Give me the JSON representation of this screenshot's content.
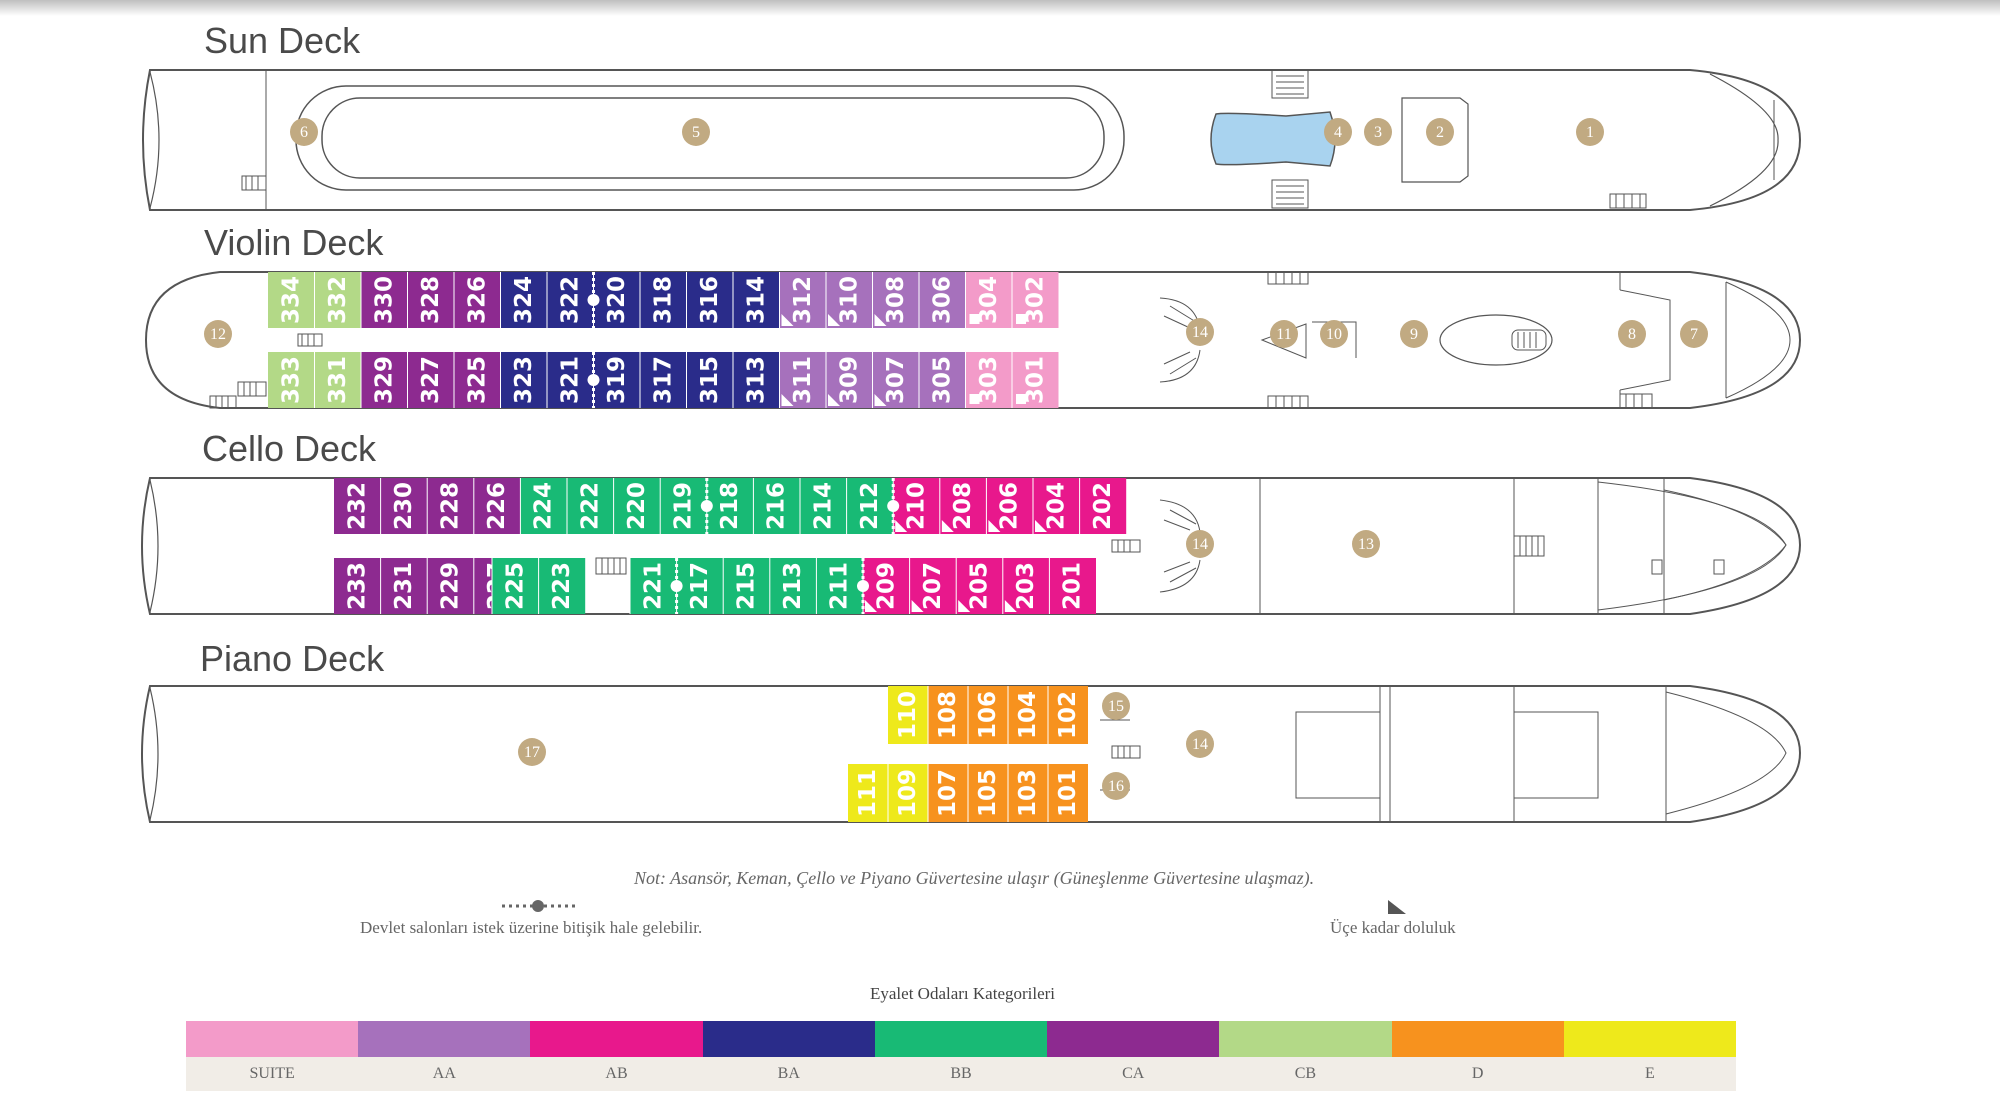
{
  "decks": [
    {
      "id": "sun",
      "title": "Sun Deck",
      "pois": [
        "6",
        "5",
        "4",
        "3",
        "2",
        "1"
      ]
    },
    {
      "id": "violin",
      "title": "Violin Deck",
      "cabins_top": [
        {
          "num": "334",
          "cat": "CB"
        },
        {
          "num": "332",
          "cat": "CB"
        },
        {
          "num": "330",
          "cat": "CA"
        },
        {
          "num": "328",
          "cat": "CA"
        },
        {
          "num": "326",
          "cat": "CA"
        },
        {
          "num": "324",
          "cat": "BA"
        },
        {
          "num": "322",
          "cat": "BA"
        },
        {
          "num": "320",
          "cat": "BA"
        },
        {
          "num": "318",
          "cat": "BA"
        },
        {
          "num": "316",
          "cat": "BA"
        },
        {
          "num": "314",
          "cat": "BA"
        },
        {
          "num": "312",
          "cat": "AA"
        },
        {
          "num": "310",
          "cat": "AA"
        },
        {
          "num": "308",
          "cat": "AA"
        },
        {
          "num": "306",
          "cat": "AA"
        },
        {
          "num": "304",
          "cat": "SUITE"
        },
        {
          "num": "302",
          "cat": "SUITE"
        }
      ],
      "cabins_bottom": [
        {
          "num": "333",
          "cat": "CB"
        },
        {
          "num": "331",
          "cat": "CB"
        },
        {
          "num": "329",
          "cat": "CA"
        },
        {
          "num": "327",
          "cat": "CA"
        },
        {
          "num": "325",
          "cat": "CA"
        },
        {
          "num": "323",
          "cat": "BA"
        },
        {
          "num": "321",
          "cat": "BA"
        },
        {
          "num": "319",
          "cat": "BA"
        },
        {
          "num": "317",
          "cat": "BA"
        },
        {
          "num": "315",
          "cat": "BA"
        },
        {
          "num": "313",
          "cat": "BA"
        },
        {
          "num": "311",
          "cat": "AA"
        },
        {
          "num": "309",
          "cat": "AA"
        },
        {
          "num": "307",
          "cat": "AA"
        },
        {
          "num": "305",
          "cat": "AA"
        },
        {
          "num": "303",
          "cat": "SUITE"
        },
        {
          "num": "301",
          "cat": "SUITE"
        }
      ],
      "pois": [
        "12",
        "14",
        "11",
        "10",
        "9",
        "8",
        "7"
      ]
    },
    {
      "id": "cello",
      "title": "Cello Deck",
      "cabins_top": [
        {
          "num": "232",
          "cat": "CA"
        },
        {
          "num": "230",
          "cat": "CA"
        },
        {
          "num": "228",
          "cat": "CA"
        },
        {
          "num": "226",
          "cat": "CA"
        },
        {
          "num": "224",
          "cat": "BB"
        },
        {
          "num": "222",
          "cat": "BB"
        },
        {
          "num": "220",
          "cat": "BB"
        },
        {
          "num": "219",
          "cat": "BB"
        },
        {
          "num": "218",
          "cat": "BB"
        },
        {
          "num": "216",
          "cat": "BB"
        },
        {
          "num": "214",
          "cat": "BB"
        },
        {
          "num": "212",
          "cat": "BB"
        },
        {
          "num": "210",
          "cat": "AB"
        },
        {
          "num": "208",
          "cat": "AB"
        },
        {
          "num": "206",
          "cat": "AB"
        },
        {
          "num": "204",
          "cat": "AB"
        },
        {
          "num": "202",
          "cat": "AB"
        }
      ],
      "cabins_bottom": [
        {
          "num": "233",
          "cat": "CA"
        },
        {
          "num": "231",
          "cat": "CA"
        },
        {
          "num": "229",
          "cat": "CA"
        },
        {
          "num": "227",
          "cat": "CA"
        },
        {
          "num": "225",
          "cat": "BB"
        },
        {
          "num": "223",
          "cat": "BB"
        },
        {
          "num": "221",
          "cat": "BB"
        },
        {
          "num": "217",
          "cat": "BB"
        },
        {
          "num": "215",
          "cat": "BB"
        },
        {
          "num": "213",
          "cat": "BB"
        },
        {
          "num": "211",
          "cat": "BB"
        },
        {
          "num": "209",
          "cat": "AB"
        },
        {
          "num": "207",
          "cat": "AB"
        },
        {
          "num": "205",
          "cat": "AB"
        },
        {
          "num": "203",
          "cat": "AB"
        },
        {
          "num": "201",
          "cat": "AB"
        }
      ],
      "pois": [
        "14",
        "13"
      ]
    },
    {
      "id": "piano",
      "title": "Piano Deck",
      "cabins_top": [
        {
          "num": "110",
          "cat": "E"
        },
        {
          "num": "108",
          "cat": "D"
        },
        {
          "num": "106",
          "cat": "D"
        },
        {
          "num": "104",
          "cat": "D"
        },
        {
          "num": "102",
          "cat": "D"
        }
      ],
      "cabins_bottom": [
        {
          "num": "111",
          "cat": "E"
        },
        {
          "num": "109",
          "cat": "E"
        },
        {
          "num": "107",
          "cat": "D"
        },
        {
          "num": "105",
          "cat": "D"
        },
        {
          "num": "103",
          "cat": "D"
        },
        {
          "num": "101",
          "cat": "D"
        }
      ],
      "pois": [
        "17",
        "15",
        "16",
        "14"
      ]
    }
  ],
  "notes": {
    "elevator": "Not: Asansör, Keman, Çello ve Piyano Güvertesine ulaşır (Güneşlenme Güvertesine ulaşmaz).",
    "adjoining": "Devlet salonları istek üzerine bitişik hale gelebilir.",
    "triple": "Üçe kadar doluluk"
  },
  "legend": {
    "title": "Eyalet Odaları Kategorileri",
    "categories": [
      {
        "code": "SUITE",
        "color": "#f39bc9"
      },
      {
        "code": "AA",
        "color": "#a671bc"
      },
      {
        "code": "AB",
        "color": "#e8188c"
      },
      {
        "code": "BA",
        "color": "#2a2c8a"
      },
      {
        "code": "BB",
        "color": "#18ba75"
      },
      {
        "code": "CA",
        "color": "#8d2a90"
      },
      {
        "code": "CB",
        "color": "#b3d987"
      },
      {
        "code": "D",
        "color": "#f7921e"
      },
      {
        "code": "E",
        "color": "#eee91b"
      }
    ]
  },
  "colors": {
    "hull_stroke": "#555555",
    "poi_fill": "#c1aa82",
    "pool_fill": "#a9d3ef"
  }
}
